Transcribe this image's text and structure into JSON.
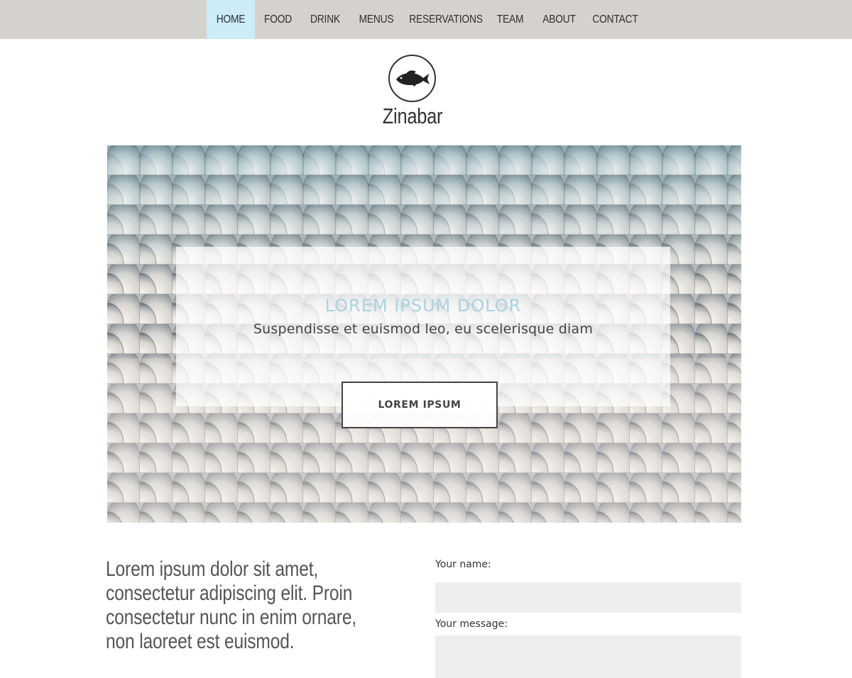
{
  "nav": {
    "items": [
      {
        "label": "HOME",
        "active": true
      },
      {
        "label": "FOOD",
        "active": false
      },
      {
        "label": "DRINK",
        "active": false
      },
      {
        "label": "MENUS",
        "active": false
      },
      {
        "label": "RESERVATIONS",
        "active": false
      },
      {
        "label": "TEAM",
        "active": false
      },
      {
        "label": "ABOUT",
        "active": false
      },
      {
        "label": "CONTACT",
        "active": false
      }
    ],
    "background_color": "#d5d1cc",
    "active_color": "#ccecf7"
  },
  "brand": {
    "logo_icon": "fish-icon",
    "name": "Zinabar"
  },
  "hero": {
    "title": "LOREM IPSUM DOLOR",
    "subtitle": "Suspendisse et euismod leo, eu scelerisque diam",
    "button_label": "LOREM IPSUM",
    "title_color": "#a9d3e3"
  },
  "intro": {
    "text": "Lorem ipsum dolor sit amet, consectetur adipiscing elit. Proin consectetur nunc in enim ornare, non laoreet est euismod."
  },
  "contact_form": {
    "name_label": "Your name:",
    "name_value": "",
    "message_label": "Your message:",
    "message_value": ""
  }
}
